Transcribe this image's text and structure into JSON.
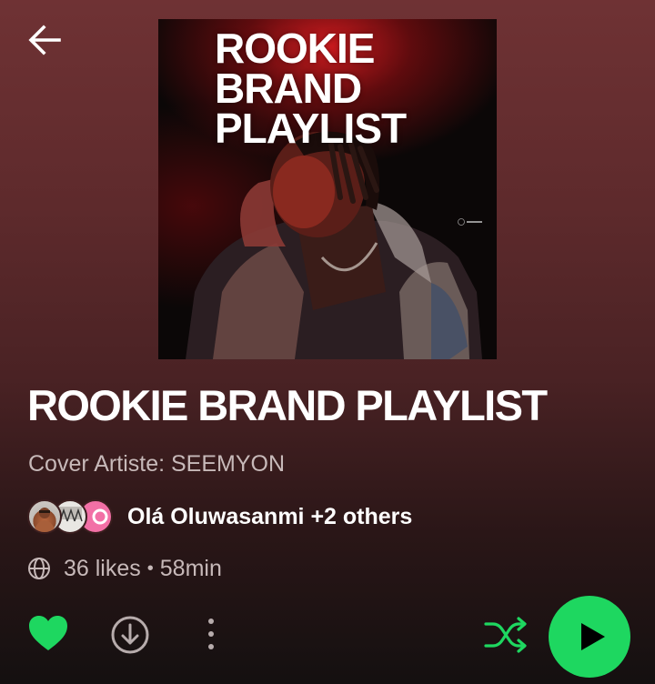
{
  "cover": {
    "title_lines": [
      "ROOKIE",
      "BRAND",
      "PLAYLIST"
    ]
  },
  "playlist": {
    "title": "ROOKIE BRAND PLAYLIST",
    "description": "Cover Artiste: SEEMYON",
    "owners": "Olá Oluwasanmi +2 others",
    "likes": "36 likes",
    "separator": "•",
    "duration": "58min",
    "liked": true
  },
  "colors": {
    "accent": "#1ed760",
    "background_top": "#6f3234",
    "background_bottom": "#141010"
  },
  "icons": {
    "back": "arrow-left-icon",
    "globe": "globe-icon",
    "like": "heart-icon",
    "download": "download-icon",
    "more": "more-vertical-icon",
    "shuffle": "shuffle-icon",
    "play": "play-icon"
  }
}
